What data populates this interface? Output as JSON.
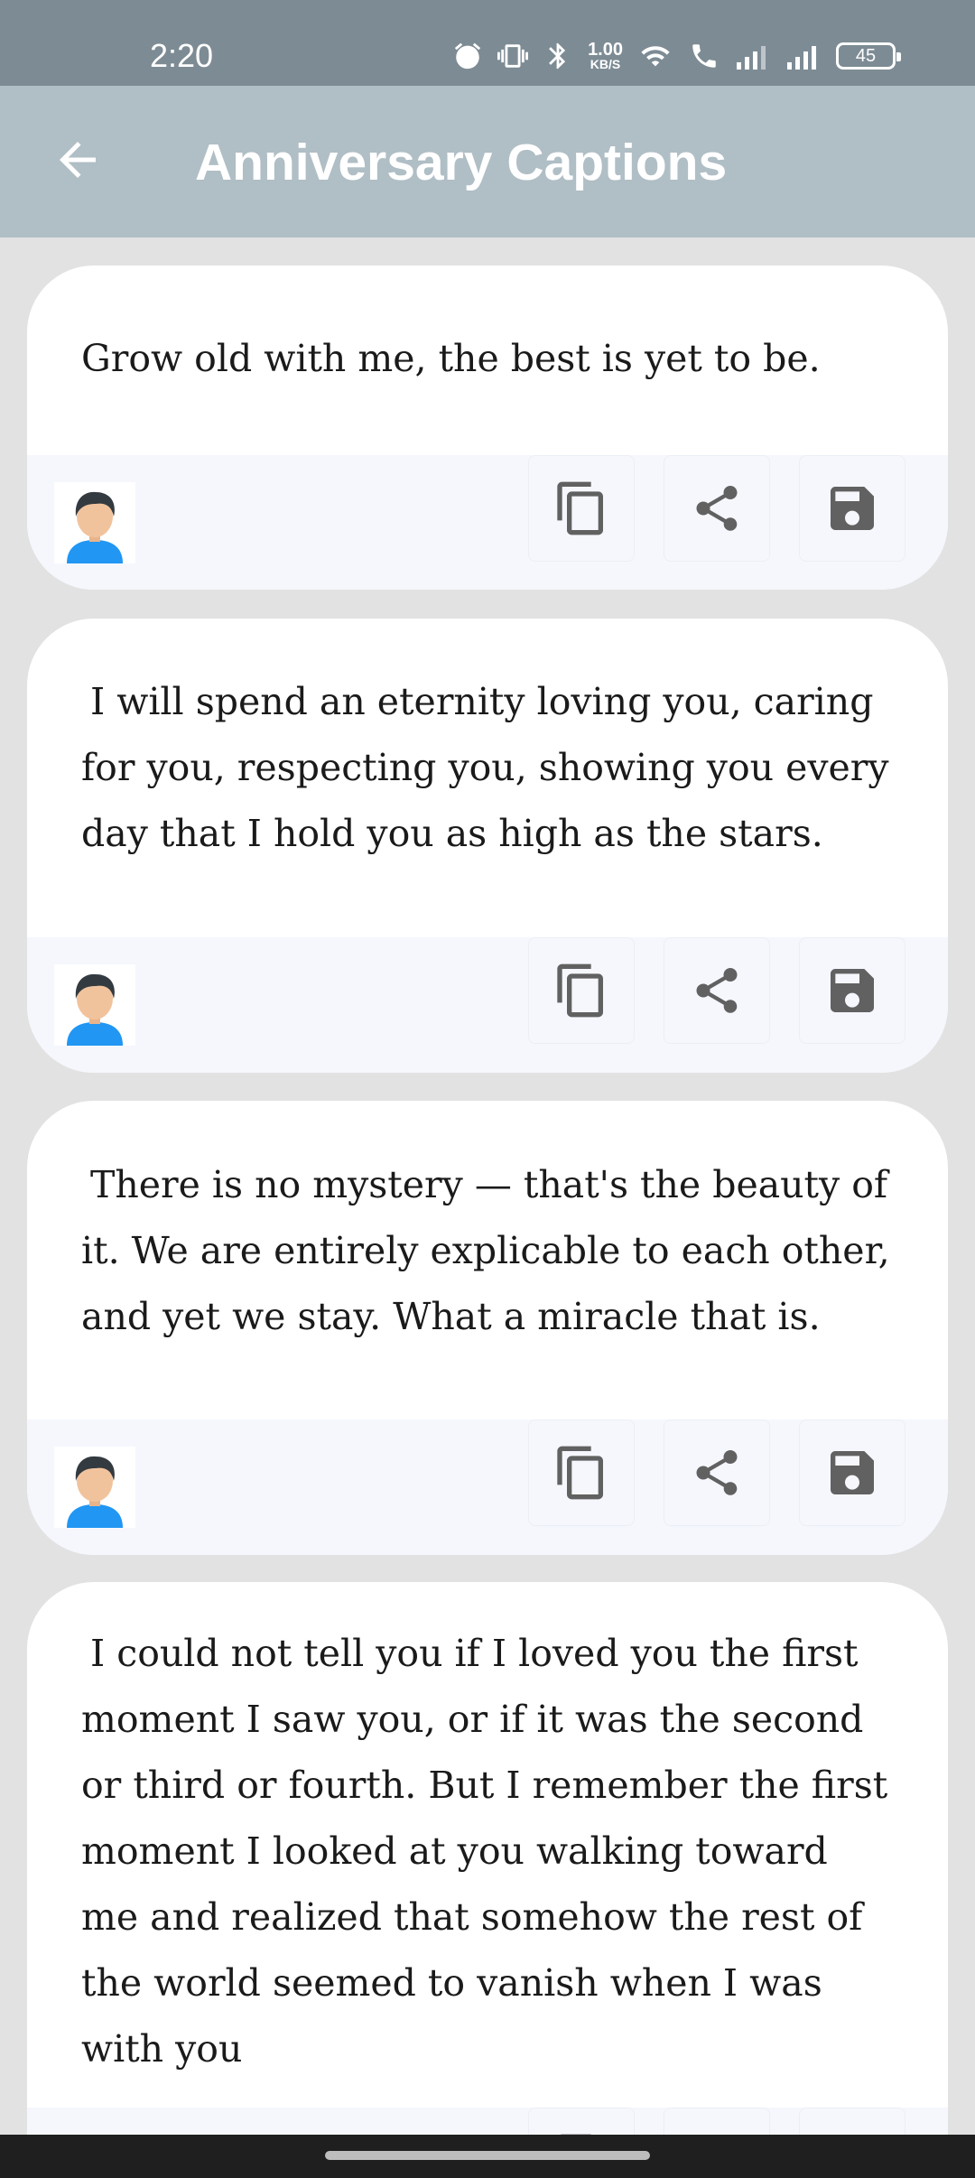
{
  "status_bar": {
    "time": "2:20",
    "net_speed_value": "1.00",
    "net_speed_unit": "KB/S",
    "battery": "45"
  },
  "app_bar": {
    "title": "Anniversary Captions",
    "back_icon": "arrow-back-icon"
  },
  "captions": [
    {
      "text": "Grow old with me, the best is yet to be."
    },
    {
      "text": "I will spend an eternity loving you, caring for you, respecting you, showing you every day that I hold you as high as the stars."
    },
    {
      "text": "There is no mystery — that's the beauty of it. We are entirely explicable to each other, and yet we stay. What a miracle that is."
    },
    {
      "text": "I could not tell you if I loved you the first moment I saw you, or if it was the second or third or fourth. But I remember the first moment I looked at you walking toward me and realized that somehow the rest of the world seemed to vanish when I was with you"
    }
  ],
  "card_actions": {
    "avatar_icon": "user-avatar-icon",
    "copy_icon": "copy-icon",
    "share_icon": "share-icon",
    "save_icon": "save-icon"
  },
  "colors": {
    "status_bar": "#7d8b94",
    "app_bar": "#b0bec5",
    "background": "#e2e2e2",
    "card": "#ffffff",
    "action_bar": "#f5f7fd",
    "icon": "#616161"
  }
}
